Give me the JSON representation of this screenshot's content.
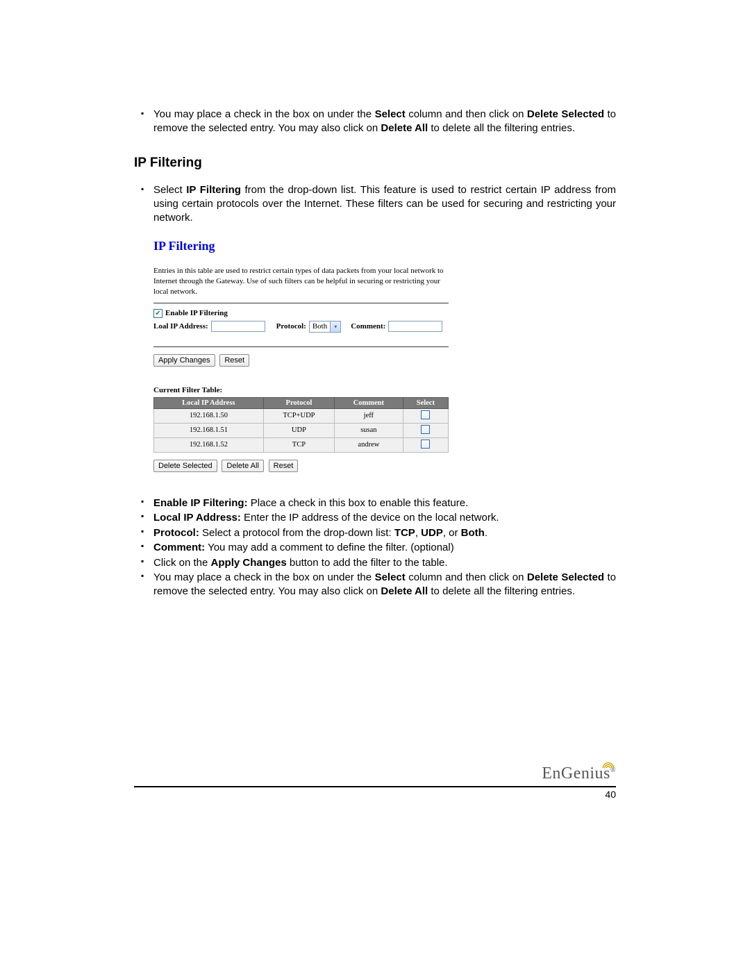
{
  "intro_bullets": {
    "select_delete": {
      "pre": "You may place a check in the box on under the ",
      "b1": "Select",
      "mid1": " column and then click on ",
      "b2": "Delete Selected",
      "mid2": " to remove the selected entry. You may also click on ",
      "b3": "Delete All",
      "post": " to delete all the filtering entries."
    }
  },
  "section_heading": "IP Filtering",
  "section_intro": {
    "pre": "Select ",
    "b1": "IP Filtering",
    "post": " from the drop-down list. This feature is used to restrict certain IP address from using certain protocols over the Internet. These filters can be used for securing and restricting your network."
  },
  "screenshot": {
    "title": "IP Filtering",
    "intro": "Entries in this table are used to restrict certain types of data packets from your local network to Internet through the Gateway. Use of such filters can be helpful in securing or restricting your local network.",
    "enable_checkbox_checked": true,
    "enable_label": "Enable IP Filtering",
    "ip_label": "Loal IP Address:",
    "protocol_label": "Protocol:",
    "protocol_value": "Both",
    "comment_label": "Comment:",
    "apply_btn": "Apply Changes",
    "reset_btn": "Reset",
    "table_caption": "Current Filter Table:",
    "table_headers": {
      "ip": "Local IP Address",
      "protocol": "Protocol",
      "comment": "Comment",
      "select": "Select"
    },
    "rows": [
      {
        "ip": "192.168.1.50",
        "protocol": "TCP+UDP",
        "comment": "jeff"
      },
      {
        "ip": "192.168.1.51",
        "protocol": "UDP",
        "comment": "susan"
      },
      {
        "ip": "192.168.1.52",
        "protocol": "TCP",
        "comment": "andrew"
      }
    ],
    "delete_selected_btn": "Delete Selected",
    "delete_all_btn": "Delete All",
    "reset2_btn": "Reset"
  },
  "explain_bullets": {
    "b1": {
      "label": "Enable IP Filtering:",
      "text": " Place a check in this box to enable this feature."
    },
    "b2": {
      "label": "Local IP Address:",
      "text": " Enter the IP address of the device on the local network."
    },
    "b3": {
      "label": "Protocol:",
      "pre": " Select a protocol from the drop-down list: ",
      "p1": "TCP",
      "c1": ", ",
      "p2": "UDP",
      "c2": ", or ",
      "p3": "Both",
      "c3": "."
    },
    "b4": {
      "label": "Comment:",
      "text": " You may add a comment to define the filter. (optional)"
    },
    "b5": {
      "pre": "Click on the ",
      "label": "Apply Changes",
      "post": " button to add the filter to the table."
    },
    "b6": {
      "pre": "You may place a check in the box on under the ",
      "s1": "Select",
      "mid1": " column and then click on ",
      "s2": "Delete Selected",
      "mid2": " to remove the selected entry. You may also click on ",
      "s3": "Delete All",
      "post": " to delete all the filtering entries."
    }
  },
  "footer": {
    "brand_a": "EnGen",
    "brand_b": "ius",
    "page": "40"
  }
}
